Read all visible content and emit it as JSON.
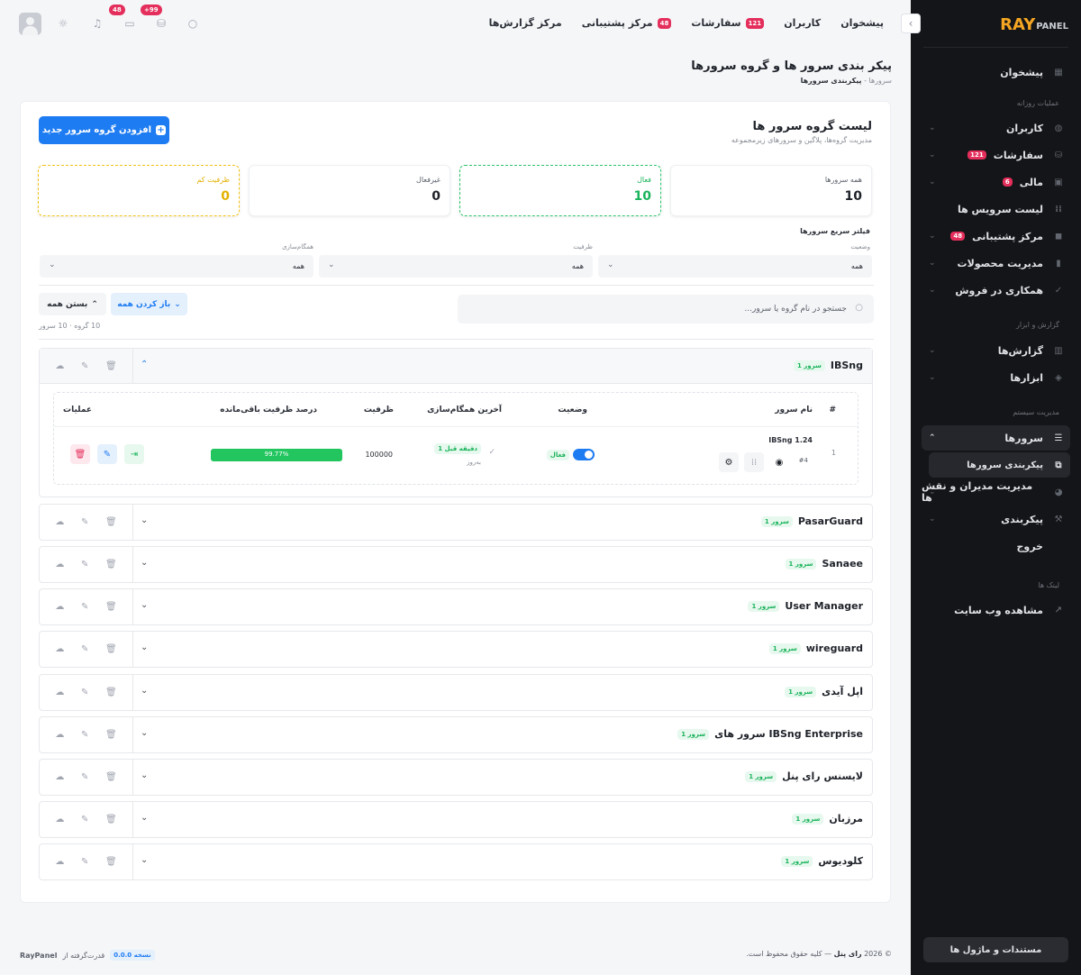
{
  "sidebar": {
    "logo_main": "RAY",
    "logo_sub": "PANEL",
    "sections": {
      "daily": "عملیات روزانه",
      "reports": "گزارش و ابزار",
      "system": "مدیریت سیستم",
      "links": "لینک ها"
    },
    "items": {
      "dashboard": "پیشخوان",
      "users": "کاربران",
      "orders": "سفارشات",
      "orders_badge": "121",
      "finance": "مالی",
      "finance_badge": "6",
      "services": "لیست سرویس ها",
      "support": "مرکز پشتیبانی",
      "support_badge": "48",
      "products": "مدیریت محصولات",
      "affiliate": "همکاری در فروش",
      "reports": "گزارش‌ها",
      "tools": "ابزارها",
      "servers": "سرورها",
      "server_config": "پیکربندی سرورها",
      "admins": "مدیریت مدیران و نقش ها",
      "config": "پیکربندی",
      "logout": "خروج",
      "website": "مشاهده وب سایت"
    },
    "docs_button": "مستندات و ماژول ها"
  },
  "header": {
    "nav": {
      "dashboard": "پیشخوان",
      "users": "کاربران",
      "orders": "سفارشات",
      "orders_badge": "121",
      "support": "مرکز پشتیبانی",
      "support_badge": "48",
      "reports": "مرکز گزارش‌ها"
    },
    "cart_badge": "+99",
    "chat_badge": "48"
  },
  "page": {
    "title": "پیکر بندی سرور ها و گروه سرورها",
    "breadcrumb_parent": "سرورها",
    "breadcrumb_sep": "-",
    "breadcrumb_current": "پیکربندی سرورها"
  },
  "card": {
    "title": "لیست گروه سرور ها",
    "subtitle": "مدیریت گروه‌ها، پلاگین و سرورهای زیرمجموعه",
    "add_button": "افزودن گروه سرور جدید",
    "stats": {
      "all_label": "همه سرورها",
      "all_value": "10",
      "active_label": "فعال",
      "active_value": "10",
      "inactive_label": "غیرفعال",
      "inactive_value": "0",
      "low_label": "ظرفیت کم",
      "low_value": "0"
    },
    "filter_title": "فیلتر سریع سرورها",
    "filters": {
      "status_label": "وضعیت",
      "status_value": "همه",
      "capacity_label": "ظرفیت",
      "capacity_value": "همه",
      "sync_label": "همگام‌سازی",
      "sync_value": "همه"
    },
    "search_placeholder": "جستجو در نام گروه یا سرور...",
    "expand_all": "باز کردن همه",
    "collapse_all": "بستن همه",
    "count_text": "10 گروه · 10 سرور"
  },
  "table": {
    "headers": {
      "index": "#",
      "name": "نام سرور",
      "status": "وضعیت",
      "last_sync": "آخرین همگام‌سازی",
      "capacity": "ظرفیت",
      "remaining": "درصد ظرفیت باقی‌مانده",
      "actions": "عملیات"
    },
    "row": {
      "index": "1",
      "name": "IBSng 1.24",
      "id_tag": "#4",
      "status": "فعال",
      "sync_time": "1 دقیقه قبل",
      "sync_sub": "به‌روز",
      "capacity": "100000",
      "remaining_text": "99.77%",
      "remaining_value": 99.77
    }
  },
  "groups": [
    {
      "name": "IBSng",
      "badge": "1 سرور"
    },
    {
      "name": "PasarGuard",
      "badge": "1 سرور"
    },
    {
      "name": "Sanaee",
      "badge": "1 سرور"
    },
    {
      "name": "User Manager",
      "badge": "1 سرور"
    },
    {
      "name": "wireguard",
      "badge": "1 سرور"
    },
    {
      "name": "اپل آیدی",
      "badge": "1 سرور"
    },
    {
      "name": "سرور های IBSng Enterprise",
      "badge": "1 سرور"
    },
    {
      "name": "لایسنس رای پنل",
      "badge": "1 سرور"
    },
    {
      "name": "مرزبان",
      "badge": "1 سرور"
    },
    {
      "name": "کلودیوس",
      "badge": "1 سرور"
    }
  ],
  "footer": {
    "copyright_year": "© 2026",
    "brand": "رای پنل",
    "dash": "—",
    "rights": "کلیه حقوق محفوظ است.",
    "version": "نسخه 0.0.0",
    "powered": "قدرت‌گرفته از",
    "powered_brand": "RayPanel"
  },
  "colors": {
    "primary": "#1e7cf2",
    "success": "#22c55e",
    "warning": "#f2c216",
    "danger": "#e42e5b",
    "sidebar": "#141518"
  }
}
